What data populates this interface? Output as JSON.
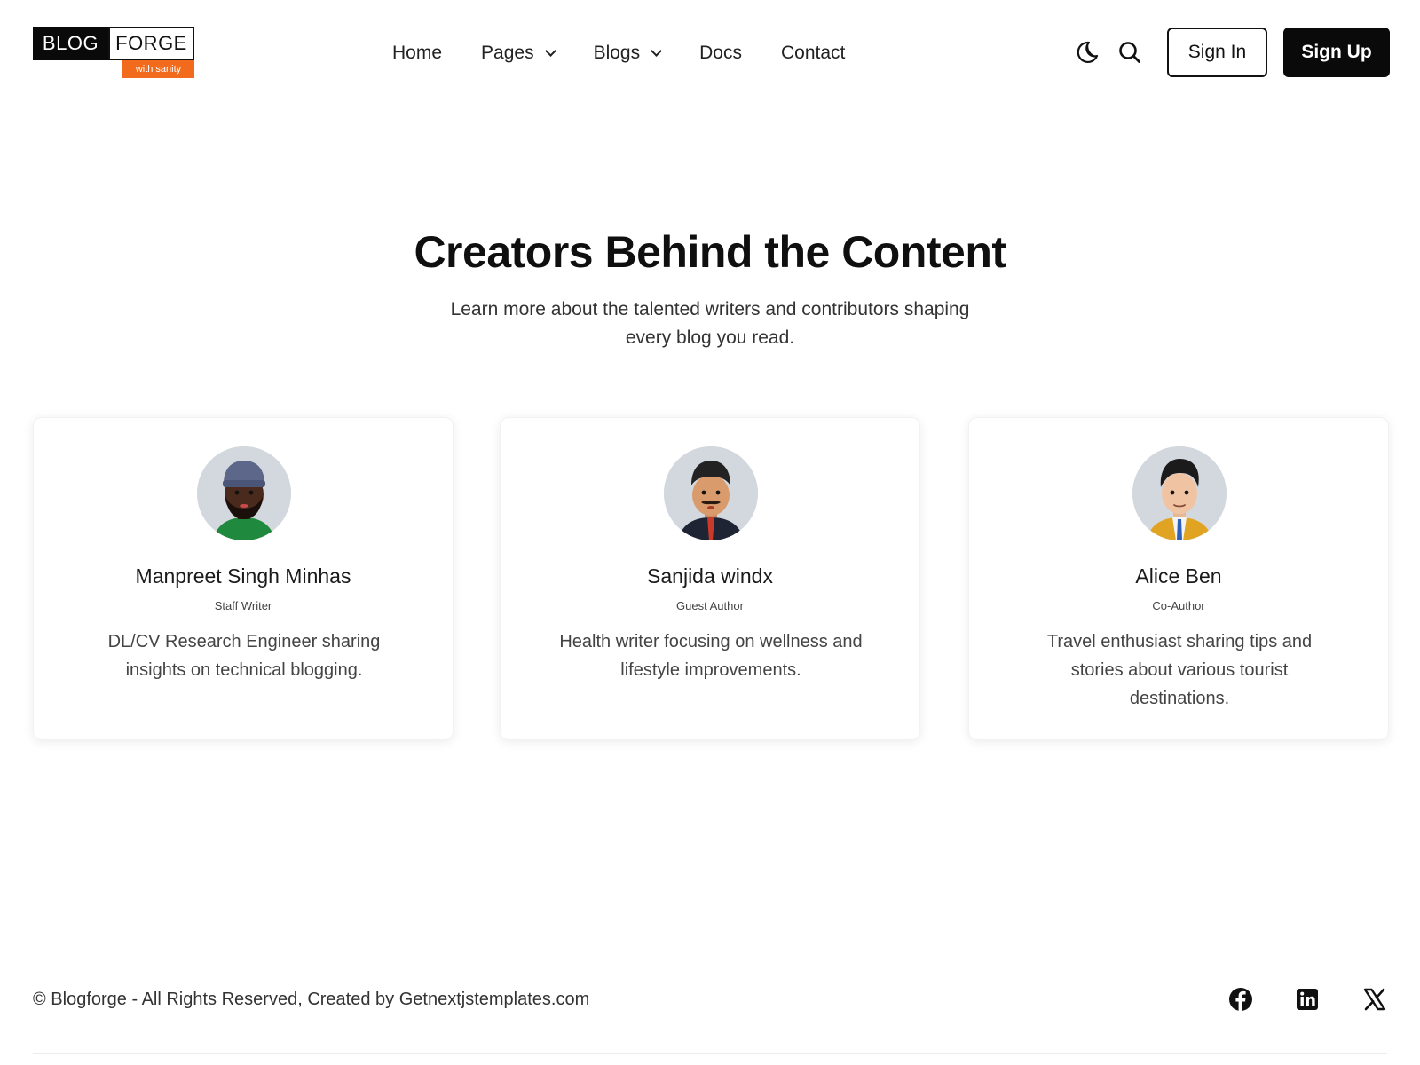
{
  "header": {
    "logo": {
      "word1": "BLOG",
      "word2": "FORGE",
      "tagline": "with sanity"
    },
    "nav": [
      {
        "label": "Home",
        "has_dropdown": false
      },
      {
        "label": "Pages",
        "has_dropdown": true
      },
      {
        "label": "Blogs",
        "has_dropdown": true
      },
      {
        "label": "Docs",
        "has_dropdown": false
      },
      {
        "label": "Contact",
        "has_dropdown": false
      }
    ],
    "icons": {
      "theme_toggle": "moon-icon",
      "search": "search-icon"
    },
    "signin_label": "Sign In",
    "signup_label": "Sign Up"
  },
  "hero": {
    "title": "Creators Behind the Content",
    "subtitle": "Learn more about the talented writers and contributors shaping every blog you read."
  },
  "authors": [
    {
      "name": "Manpreet Singh Minhas",
      "role": "Staff Writer",
      "bio": "DL/CV Research Engineer sharing insights on technical blogging."
    },
    {
      "name": "Sanjida windx",
      "role": "Guest Author",
      "bio": "Health writer focusing on wellness and lifestyle improvements."
    },
    {
      "name": "Alice Ben",
      "role": "Co-Author",
      "bio": "Travel enthusiast sharing tips and stories about various tourist destinations."
    }
  ],
  "footer": {
    "copyright": "© Blogforge - All Rights Reserved, Created by Getnextjstemplates.com",
    "social": [
      "facebook-icon",
      "linkedin-icon",
      "x-icon"
    ]
  },
  "colors": {
    "brand_orange": "#f26a1b",
    "primary_dark": "#0a0a0a",
    "avatar_bg": "#d3d8de"
  }
}
